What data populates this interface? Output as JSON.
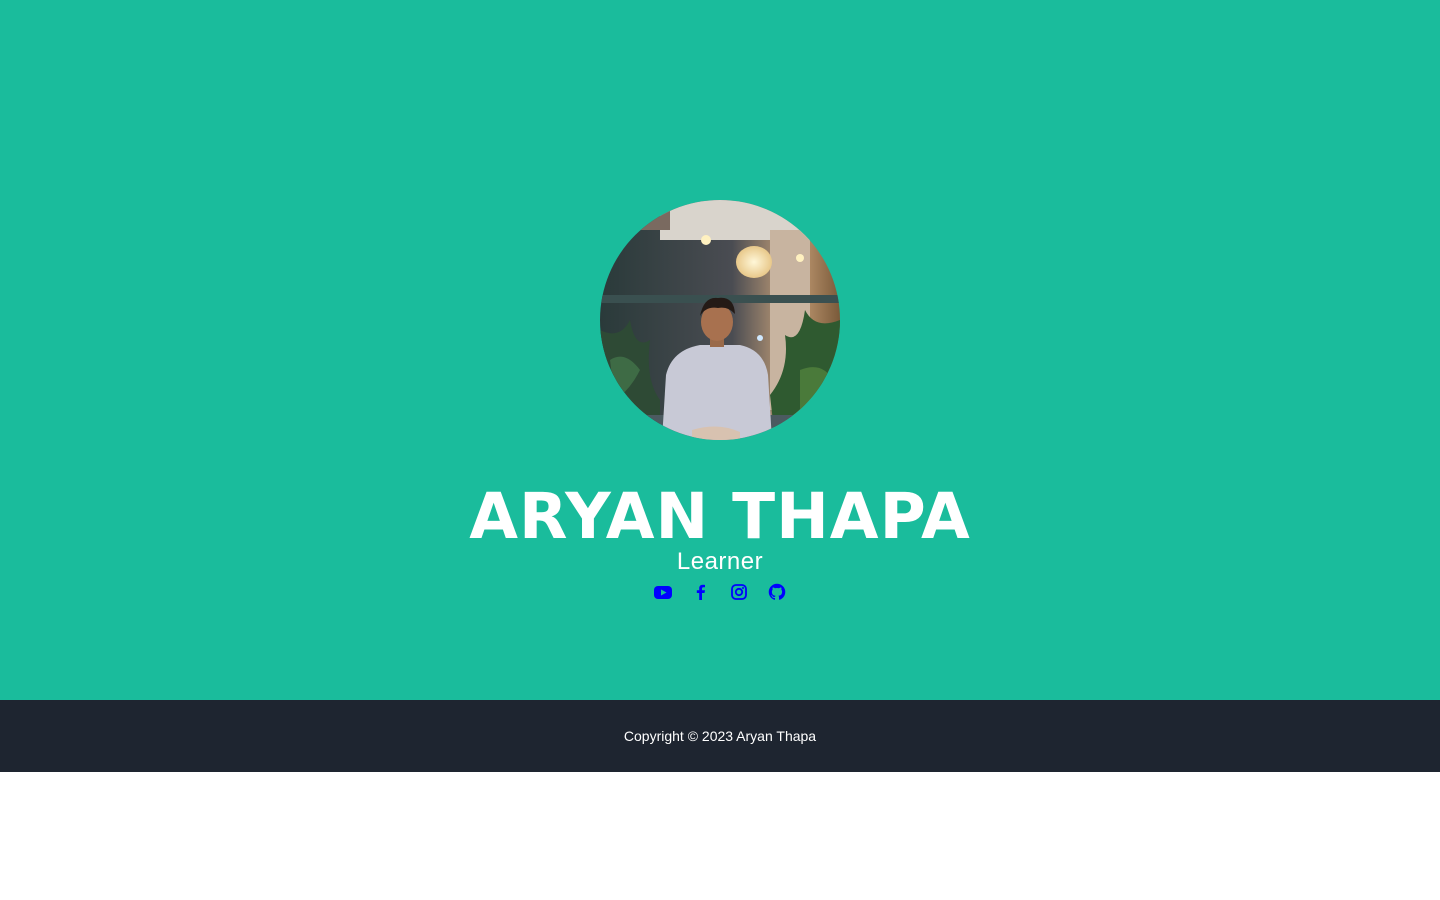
{
  "profile": {
    "name": "ARYAN THAPA",
    "role": "Learner",
    "avatar_icon": "profile-photo"
  },
  "socials": [
    {
      "icon": "youtube-icon",
      "label": "YouTube"
    },
    {
      "icon": "facebook-icon",
      "label": "Facebook"
    },
    {
      "icon": "instagram-icon",
      "label": "Instagram"
    },
    {
      "icon": "github-icon",
      "label": "GitHub"
    }
  ],
  "footer": {
    "copyright": "Copyright © 2023 Aryan Thapa"
  },
  "colors": {
    "hero_bg": "#1abc9c",
    "footer_bg": "#1e2530",
    "icon": "#0000ff",
    "text": "#ffffff"
  }
}
